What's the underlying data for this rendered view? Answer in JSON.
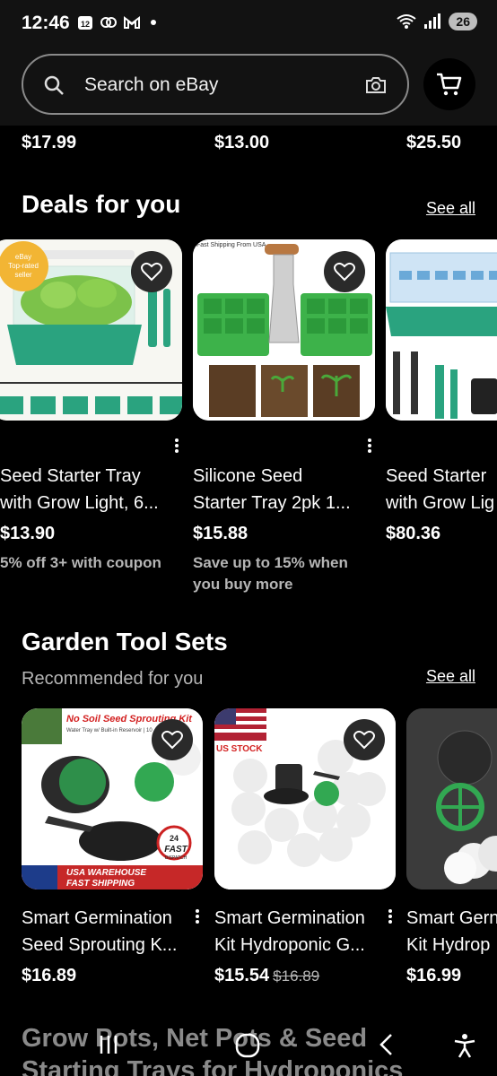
{
  "status": {
    "time": "12:46",
    "battery": "26",
    "signal_label": "6"
  },
  "search": {
    "placeholder": "Search on eBay"
  },
  "top_prices": [
    "$17.99",
    "$13.00",
    "$25.50"
  ],
  "deals": {
    "title": "Deals for you",
    "see_all": "See all",
    "items": [
      {
        "title_line1": "Seed Starter Tray",
        "title_line2": "with Grow Light, 6...",
        "price": "$13.90",
        "note_line1": "5% off 3+ with coupon",
        "note_line2": "",
        "badge": "eBay Top-rated seller"
      },
      {
        "title_line1": "Silicone Seed",
        "title_line2": "Starter Tray 2pk 1...",
        "price": "$15.88",
        "note_line1": "Save up to 15% when",
        "note_line2": "you buy more",
        "banner": "Fast Shipping From USA"
      },
      {
        "title_line1": "Seed Starter",
        "title_line2": "with Grow Lig",
        "price": "$80.36",
        "note_line1": "",
        "note_line2": ""
      }
    ]
  },
  "garden": {
    "title": "Garden Tool Sets",
    "subtitle": "Recommended for you",
    "see_all": "See all",
    "items": [
      {
        "title_line1": "Smart Germination",
        "title_line2": "Seed Sprouting K...",
        "price": "$16.89",
        "strike": "",
        "banner_top": "No Soil Seed Sprouting Kit",
        "banner_sub": "Water Tray w/ Built-in Reservoir | 10 ...ers",
        "banner_bottom1": "USA WAREHOUSE",
        "banner_bottom2": "FAST SHIPPING",
        "badge_fast": "FAST",
        "badge_num": "24",
        "badge_small": "DISPATCH"
      },
      {
        "title_line1": "Smart Germination",
        "title_line2": "Kit Hydroponic G...",
        "price": "$15.54",
        "strike": "$16.89",
        "us_stock": "US STOCK"
      },
      {
        "title_line1": "Smart Gern",
        "title_line2": "Kit Hydrop",
        "price": "$16.99",
        "strike": ""
      }
    ]
  },
  "next_section": {
    "line1": "Grow Pots, Net Pots & Seed",
    "line2": "Starting Trays for Hydroponics"
  }
}
